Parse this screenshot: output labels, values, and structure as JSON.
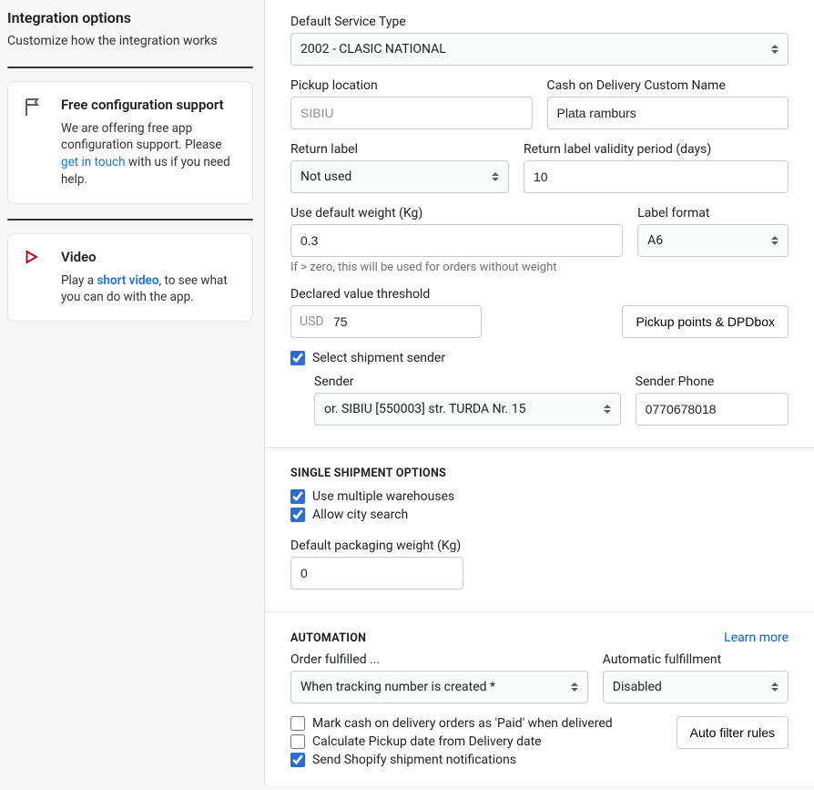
{
  "sidebar": {
    "title": "Integration options",
    "subtitle": "Customize how the integration works",
    "support": {
      "heading": "Free configuration support",
      "text1": "We are offering free app configuration support. Please ",
      "link": "get in touch",
      "text2": " with us if you need help."
    },
    "video": {
      "heading": "Video",
      "text1": "Play a ",
      "link": "short video",
      "text2": ", to see what you can do with the app."
    }
  },
  "form": {
    "service_type": {
      "label": "Default Service Type",
      "value": "2002 - CLASIC NATIONAL"
    },
    "pickup_location": {
      "label": "Pickup location",
      "value": "SIBIU"
    },
    "cod_name": {
      "label": "Cash on Delivery Custom Name",
      "value": "Plata ramburs"
    },
    "return_label": {
      "label": "Return label",
      "value": "Not used"
    },
    "return_validity": {
      "label": "Return label validity period (days)",
      "value": "10"
    },
    "default_weight": {
      "label": "Use default weight (Kg)",
      "value": "0.3",
      "hint": "If > zero, this will be used for orders without weight"
    },
    "label_format": {
      "label": "Label format",
      "value": "A6"
    },
    "declared_value": {
      "label": "Declared value threshold",
      "prefix": "USD",
      "value": "75"
    },
    "pickup_points_btn": "Pickup points & DPDbox",
    "select_sender": {
      "label": "Select shipment sender",
      "checked": true
    },
    "sender": {
      "label": "Sender",
      "value": "or. SIBIU [550003] str. TURDA Nr. 15"
    },
    "sender_phone": {
      "label": "Sender Phone",
      "value": "0770678018"
    }
  },
  "single_shipment": {
    "title": "SINGLE SHIPMENT OPTIONS",
    "multi_warehouse": {
      "label": "Use multiple warehouses",
      "checked": true
    },
    "city_search": {
      "label": "Allow city search",
      "checked": true
    },
    "pkg_weight": {
      "label": "Default packaging weight (Kg)",
      "value": "0"
    }
  },
  "automation": {
    "title": "AUTOMATION",
    "learn_more": "Learn more",
    "order_fulfilled": {
      "label": "Order fulfilled ...",
      "value": "When tracking number is created *"
    },
    "auto_fulfillment": {
      "label": "Automatic fulfillment",
      "value": "Disabled"
    },
    "mark_cod": {
      "label": "Mark cash on delivery orders as 'Paid' when delivered",
      "checked": false
    },
    "calc_pickup": {
      "label": "Calculate Pickup date from Delivery date",
      "checked": false
    },
    "send_notif": {
      "label": "Send Shopify shipment notifications",
      "checked": true
    },
    "auto_filter_btn": "Auto filter rules"
  }
}
